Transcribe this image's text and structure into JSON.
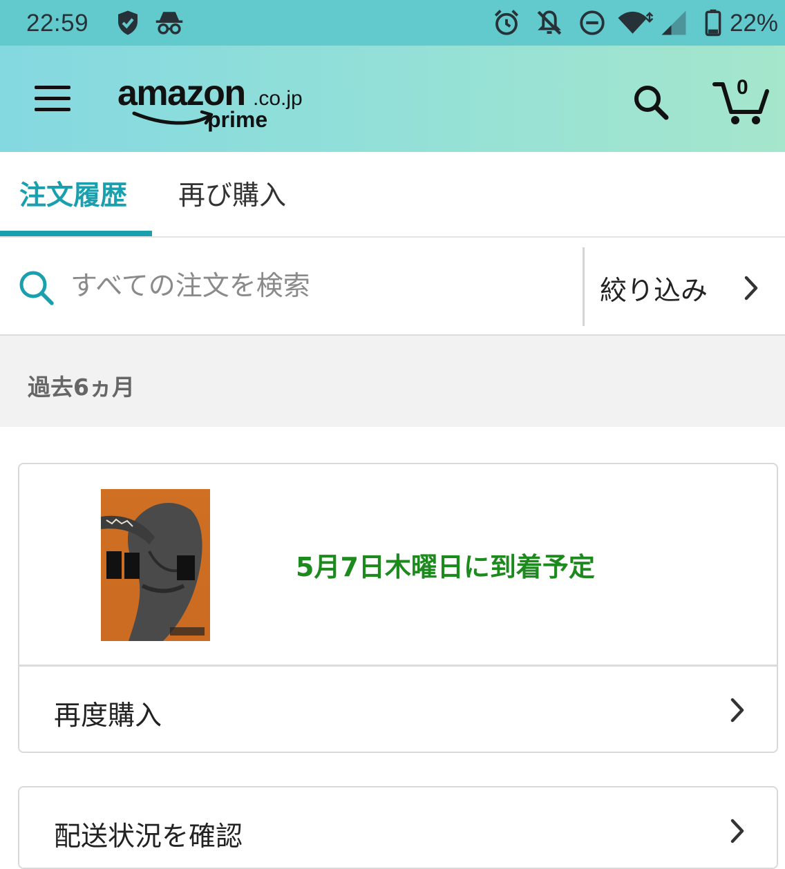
{
  "status_bar": {
    "time": "22:59",
    "battery": "22%",
    "icons": [
      "shield-check-icon",
      "incognito-icon",
      "alarm-icon",
      "bell-off-icon",
      "do-not-disturb-icon",
      "wifi-icon",
      "signal-icon",
      "battery-icon"
    ]
  },
  "app_bar": {
    "logo_main": "amazon",
    "logo_domain": ".co.jp",
    "logo_sub": "prime",
    "cart_count": "0",
    "icons": [
      "hamburger-menu-icon",
      "search-icon",
      "cart-icon"
    ]
  },
  "tabs": [
    {
      "label": "注文履歴",
      "active": true
    },
    {
      "label": "再び購入",
      "active": false
    }
  ],
  "search": {
    "placeholder": "すべての注文を検索",
    "filter_label": "絞り込み"
  },
  "section": {
    "title": "過去6ヵ月"
  },
  "orders": [
    {
      "product_image": "book-cover-ajin-16",
      "delivery_status": "5月7日木曜日に到着予定",
      "action_label": "再度購入"
    }
  ],
  "next_card": {
    "label": "配送状況を確認"
  },
  "colors": {
    "status_bar": "#62c9cd",
    "accent": "#1a9fae",
    "delivery_green": "#1d8a1d",
    "section_bg": "#f2f2f2"
  }
}
